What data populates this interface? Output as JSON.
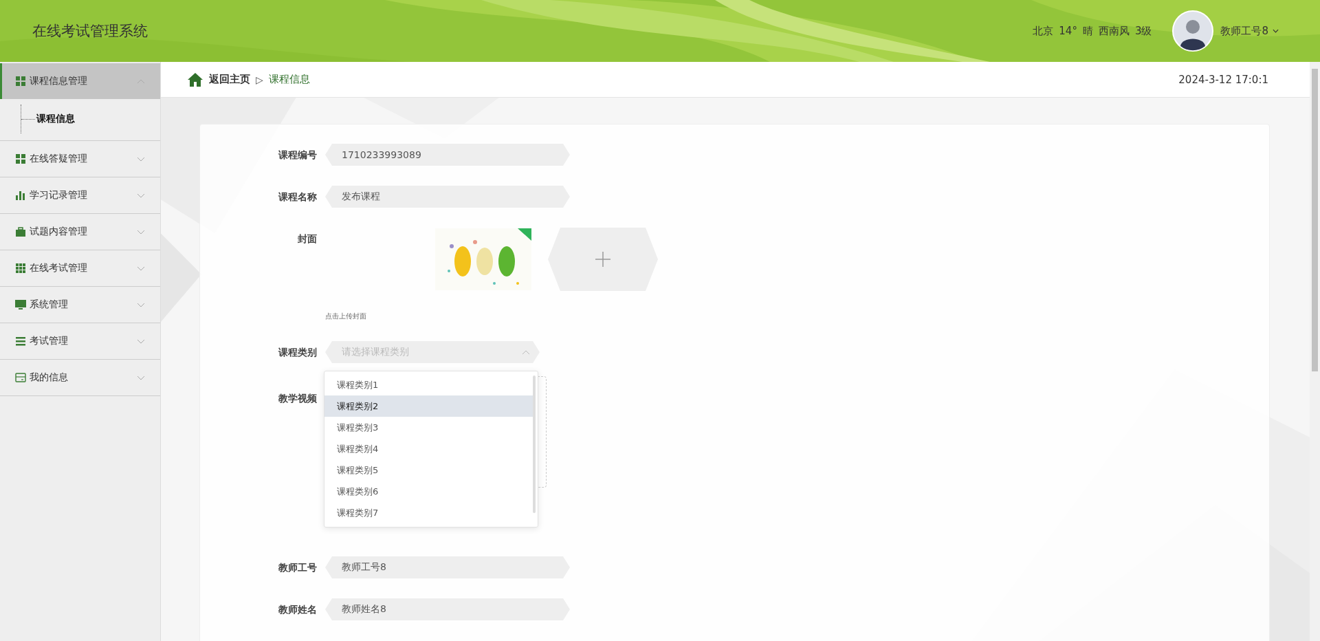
{
  "header": {
    "title": "在线考试管理系统",
    "weather": [
      "北京",
      "14°",
      "晴",
      "西南风",
      "3级"
    ],
    "user": "教师工号8"
  },
  "sidebar": {
    "items": [
      {
        "label": "课程信息管理",
        "expanded": true,
        "selected": true,
        "children": [
          {
            "label": "课程信息",
            "selected": true
          }
        ]
      },
      {
        "label": "在线答疑管理",
        "expanded": false,
        "selected": false
      },
      {
        "label": "学习记录管理",
        "expanded": false,
        "selected": false
      },
      {
        "label": "试题内容管理",
        "expanded": false,
        "selected": false
      },
      {
        "label": "在线考试管理",
        "expanded": false,
        "selected": false
      },
      {
        "label": "系统管理",
        "expanded": false,
        "selected": false
      },
      {
        "label": "考试管理",
        "expanded": false,
        "selected": false
      },
      {
        "label": "我的信息",
        "expanded": false,
        "selected": false
      }
    ]
  },
  "breadcrumb": {
    "home": "返回主页",
    "separator": "▷",
    "current": "课程信息"
  },
  "datetime": "2024-3-12 17:0:1",
  "form": {
    "fields": [
      {
        "kind": "input",
        "label": "课程编号",
        "value": "1710233993089"
      },
      {
        "kind": "input",
        "label": "课程名称",
        "value": "发布课程"
      },
      {
        "label": "封面",
        "hint": "点击上传封面"
      },
      {
        "kind": "select",
        "label": "课程类别",
        "placeholder": "请选择课程类别",
        "expanded": true,
        "options": [
          {
            "label": "课程类别1",
            "hovered": false
          },
          {
            "label": "课程类别2",
            "hovered": true
          },
          {
            "label": "课程类别3",
            "hovered": false
          },
          {
            "label": "课程类别4",
            "hovered": false
          },
          {
            "label": "课程类别5",
            "hovered": false
          },
          {
            "label": "课程类别6",
            "hovered": false
          },
          {
            "label": "课程类别7",
            "hovered": false
          }
        ]
      },
      {
        "kind": "video",
        "label": "教学视频"
      },
      {
        "kind": "input",
        "label": "教师工号",
        "value": "教师工号8"
      },
      {
        "kind": "input",
        "label": "教师姓名",
        "value": "教师姓名8"
      }
    ]
  }
}
